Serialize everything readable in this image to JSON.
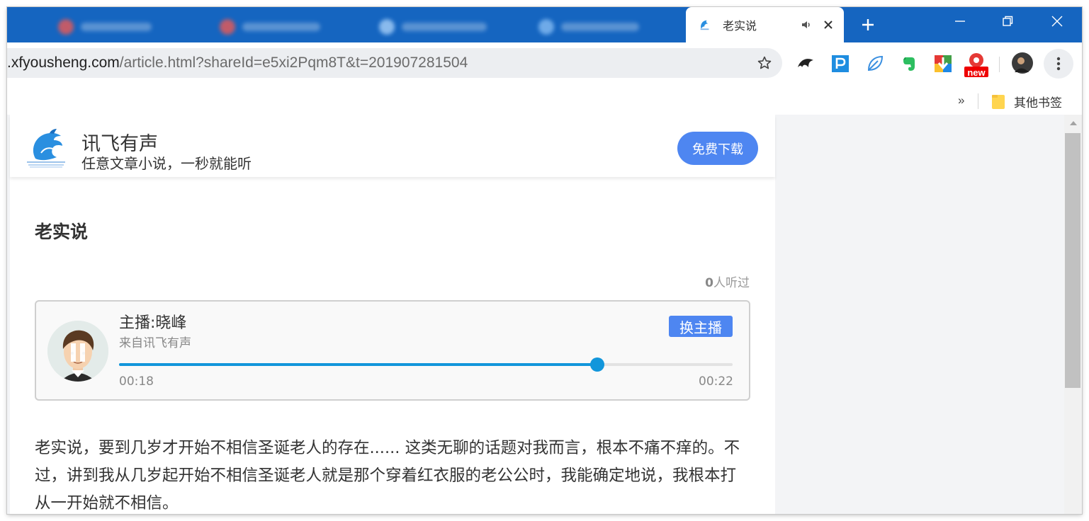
{
  "browser": {
    "tab": {
      "title": "老实说"
    },
    "address": {
      "host": ".xfyousheng.com",
      "path": "/article.html?shareId=e5xi2Pqm8T&t=201907281504"
    },
    "extensions": [
      "bird-icon",
      "p-icon",
      "leaf-icon",
      "evernote-icon",
      "download-icon",
      "new-badge-icon"
    ],
    "new_badge": "new",
    "bookmarks": {
      "overflow": "»",
      "folder": "其他书签"
    }
  },
  "site": {
    "name": "讯飞有声",
    "slogan": "任意文章小说，一秒就能听",
    "download_label": "免费下载"
  },
  "article": {
    "title": "老实说",
    "listen_count": "0",
    "listen_suffix": "人听过",
    "body": "老实说，要到几岁才开始不相信圣诞老人的存在...... 这类无聊的话题对我而言，根本不痛不痒的。不过，讲到我从几岁起开始不相信圣诞老人就是那个穿着红衣服的老公公时，我能确定地说，我根本打从一开始就不相信。"
  },
  "player": {
    "host": "主播:晓峰",
    "source": "来自讯飞有声",
    "switch_label": "换主播",
    "current_time": "00:18",
    "total_time": "00:22",
    "progress": 0.78
  },
  "colors": {
    "accent": "#4e86f1",
    "progress": "#1296db",
    "tabstrip": "#1565c0"
  }
}
